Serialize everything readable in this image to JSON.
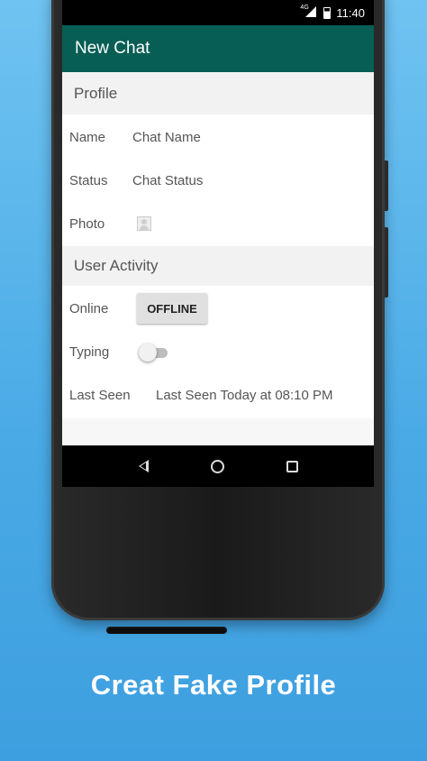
{
  "status_bar": {
    "network": "4G",
    "time": "11:40"
  },
  "toolbar": {
    "title": "New Chat"
  },
  "profile": {
    "header": "Profile",
    "name_label": "Name",
    "name_value": "Chat Name",
    "status_label": "Status",
    "status_value": "Chat Status",
    "photo_label": "Photo",
    "photo_icon": "avatar-placeholder-icon"
  },
  "activity": {
    "header": "User Activity",
    "online_label": "Online",
    "online_button": "OFFLINE",
    "typing_label": "Typing",
    "typing_on": false,
    "last_seen_label": "Last Seen",
    "last_seen_value": "Last Seen Today at 08:10 PM"
  },
  "nav": {
    "back": "back-icon",
    "home": "home-icon",
    "recents": "recents-icon"
  },
  "caption": "Creat Fake Profile",
  "colors": {
    "background": "#48a9e5",
    "toolbar": "#075e54"
  }
}
